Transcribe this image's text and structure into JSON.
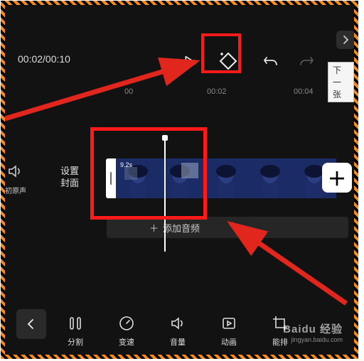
{
  "time": {
    "current": "00:02",
    "total": "00:10",
    "display": "00:02/00:10"
  },
  "ruler": {
    "t0": "00",
    "t2": "00:02",
    "t4": "00:04"
  },
  "tooltip": {
    "next": "下一张"
  },
  "sidebar": {
    "mute_label": "初原声",
    "cover_label_l1": "设置",
    "cover_label_l2": "封面"
  },
  "clip": {
    "duration": "9.2s"
  },
  "add_audio": {
    "label": "添加音频"
  },
  "tools": {
    "split": "分割",
    "speed": "变速",
    "volume": "音量",
    "anim": "动画",
    "crop_partial": "能排"
  },
  "watermark": {
    "main": "Baidu 经验",
    "sub": "jingyan.baidu.com"
  },
  "icons": {
    "play": "play-icon",
    "keyframe": "keyframe-add-icon",
    "undo": "undo-icon",
    "redo": "redo-icon",
    "next": "chevron-right-icon",
    "back": "chevron-left-icon",
    "speaker": "speaker-mute-icon",
    "plus": "plus-icon",
    "split": "split-icon",
    "speed": "speed-icon",
    "volume": "volume-icon",
    "anim": "anim-icon",
    "crop": "crop-icon"
  },
  "colors": {
    "highlight": "#ff1a1a",
    "accent_arrow": "#e1261d"
  }
}
